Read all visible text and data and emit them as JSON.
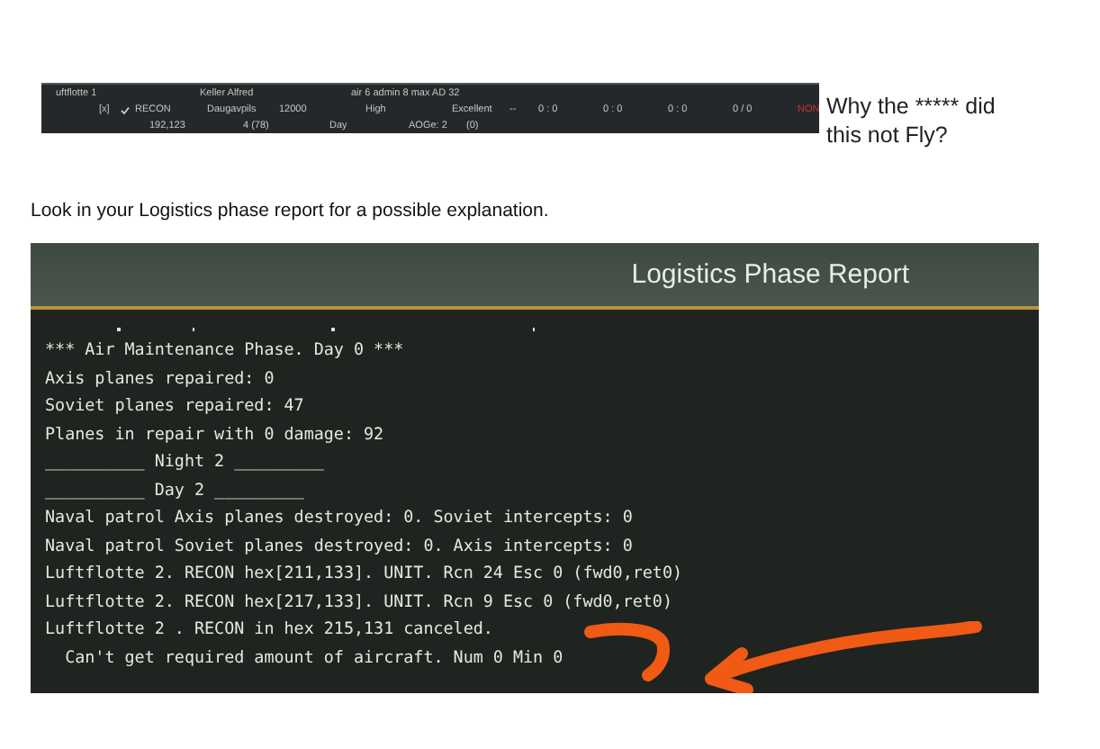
{
  "unit_strip": {
    "rows": [
      {
        "unit": "uftflotte 1",
        "commander": "Keller Alfred",
        "ratings": "air 6   admin 8   max AD 32"
      },
      {
        "checkbox": {
          "label": "[x]",
          "checked": true
        },
        "type": "RECON",
        "base": "Daugavpils",
        "column_5": "12000",
        "column_6": "High",
        "column_7": "Excellent",
        "column_8": "--",
        "column_9": "0 : 0",
        "column_10": "0 : 0",
        "column_11": "0 : 0",
        "column_12": "0 / 0",
        "status": "NON"
      },
      {
        "hex": "192,123",
        "column_2": "4 (78)",
        "column_3": "Day",
        "column_4": "AOGe: 2",
        "column_5": "(0)"
      }
    ]
  },
  "question": "Why the ***** did this not Fly?",
  "instruction": "Look in your Logistics phase report for a possible explanation.",
  "report": {
    "title": "Logistics Phase Report",
    "lines": [
      "*** Air Maintenance Phase. Day 0 ***",
      "Axis planes repaired: 0",
      "Soviet planes repaired: 47",
      "Planes in repair with 0 damage: 92",
      "__________ Night 2 _________",
      "__________ Day 2 _________",
      "Naval patrol Axis planes destroyed: 0. Soviet intercepts: 0",
      "Naval patrol Soviet planes destroyed: 0. Axis intercepts: 0",
      "Luftflotte 2. RECON hex[211,133]. UNIT. Rcn 24 Esc 0 (fwd0,ret0)",
      "Luftflotte 2. RECON hex[217,133]. UNIT. Rcn 9 Esc 0 (fwd0,ret0)",
      "Luftflotte 2 . RECON in hex 215,131 canceled.",
      "  Can't get required amount of aircraft. Num 0 Min 0"
    ]
  }
}
